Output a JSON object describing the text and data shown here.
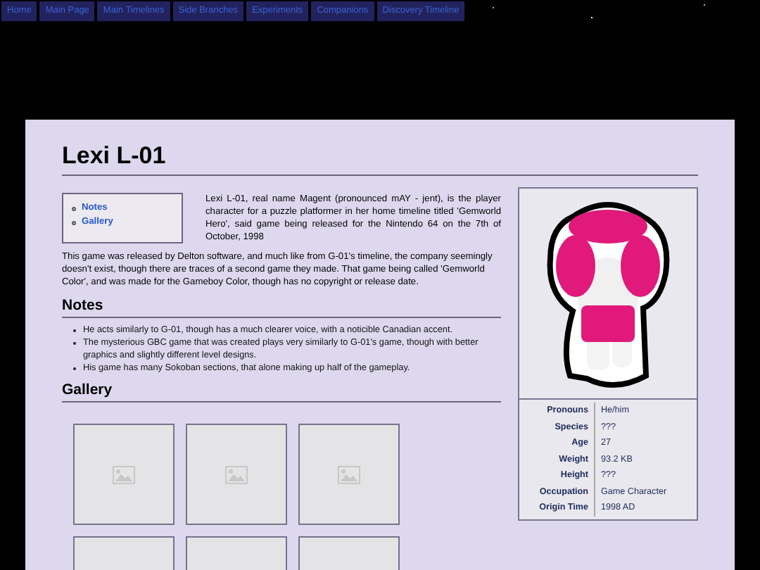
{
  "nav": {
    "tabs": [
      {
        "label": "Home",
        "selected": false
      },
      {
        "label": "Main Page",
        "selected": false
      },
      {
        "label": "Main Timelines",
        "selected": false
      },
      {
        "label": "Side Branches",
        "selected": false
      },
      {
        "label": "Experiments",
        "selected": false
      },
      {
        "label": "Companions",
        "selected": false
      },
      {
        "label": "Discovery Timeline",
        "selected": false
      }
    ]
  },
  "title": "Lexi L-01",
  "toc": [
    "Notes",
    "Gallery"
  ],
  "intro": "Lexi L-01, real name Magent (pronounced mAY - jent), is the player character for a puzzle platformer in her home timeline titled 'Gemworld Hero', said game being released for the Nintendo 64 on the 7th of October, 1998",
  "paragraph": "This game was released by Delton software, and much like from G-01's timeline, the company seemingly doesn't exist, though there are traces of a second game they made. That game being called 'Gemworld Color', and was made for the Gameboy Color, though has no copyright or release date.",
  "notes": {
    "heading": "Notes",
    "items": [
      "He acts similarly to G-01, though has a much clearer voice, with a noticible Canadian accent.",
      "The mysterious GBC game that was created plays very similarly to G-01's game, though with better graphics and slightly different level designs.",
      "His game has many Sokoban sections, that alone making up half of the gameplay."
    ]
  },
  "gallery": {
    "heading": "Gallery",
    "tiles": [
      {
        "kind": "placeholder"
      },
      {
        "kind": "placeholder"
      },
      {
        "kind": "placeholder"
      },
      {
        "kind": "cut_off"
      },
      {
        "kind": "cut_off"
      },
      {
        "kind": "cut_off"
      }
    ]
  },
  "infobox": {
    "rows": [
      {
        "label": "Pronouns",
        "value": "He/him"
      },
      {
        "label": "Species",
        "value": "???"
      },
      {
        "label": "Age",
        "value": "27"
      },
      {
        "label": "Weight",
        "value": "93.2 KB"
      },
      {
        "label": "Height",
        "value": "???"
      },
      {
        "label": "Occupation",
        "value": "Game Character"
      },
      {
        "label": "Origin Time",
        "value": "1998 AD"
      }
    ]
  }
}
